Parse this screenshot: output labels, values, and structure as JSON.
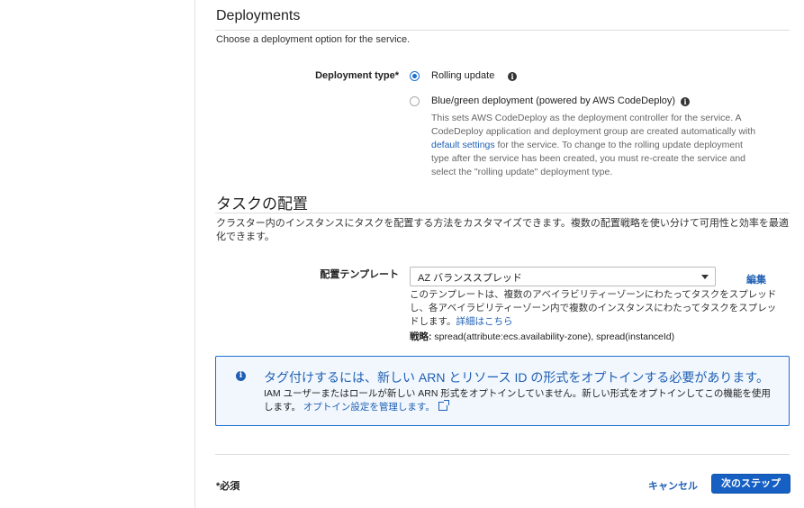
{
  "deployments": {
    "title": "Deployments",
    "description": "Choose a deployment option for the service.",
    "type_label": "Deployment type*",
    "options": [
      {
        "label": "Rolling update",
        "selected": true
      },
      {
        "label": "Blue/green deployment (powered by AWS CodeDeploy)",
        "selected": false
      }
    ],
    "bg_help_1": "This sets AWS CodeDeploy as the deployment controller for the service. A CodeDeploy application and deployment group are created automatically with ",
    "bg_help_link": "default settings",
    "bg_help_2": " for the service. To change to the rolling update deployment type after the service has been created, you must re-create the service and select the \"rolling update\" deployment type."
  },
  "placement": {
    "title": "タスクの配置",
    "description": "クラスター内のインスタンスにタスクを配置する方法をカスタマイズできます。複数の配置戦略を使い分けて可用性と効率を最適化できます。",
    "template_label": "配置テンプレート",
    "template_value": "AZ バランススプレッド",
    "edit_label": "編集",
    "help_text": "このテンプレートは、複数のアベイラビリティーゾーンにわたってタスクをスプレッドし、各アベイラビリティーゾーン内で複数のインスタンスにわたってタスクをスプレッドします。",
    "help_link": "詳細はこちら",
    "strategy_label": "戦略:",
    "strategy_value": " spread(attribute:ecs.availability-zone), spread(instanceId)"
  },
  "alert": {
    "title": "タグ付けするには、新しい ARN とリソース ID の形式をオプトインする必要があります。",
    "body": "IAM ユーザーまたはロールが新しい ARN 形式をオプトインしていません。新しい形式をオプトインしてこの機能を使用します。",
    "link": "オプトイン設定を管理します。"
  },
  "footer": {
    "required_label": "*必須",
    "cancel_label": "キャンセル",
    "next_label": "次のステップ"
  },
  "colors": {
    "accent": "#1f5fb4",
    "primary_button": "#1660c4",
    "alert_bg": "#f1f7fd"
  }
}
